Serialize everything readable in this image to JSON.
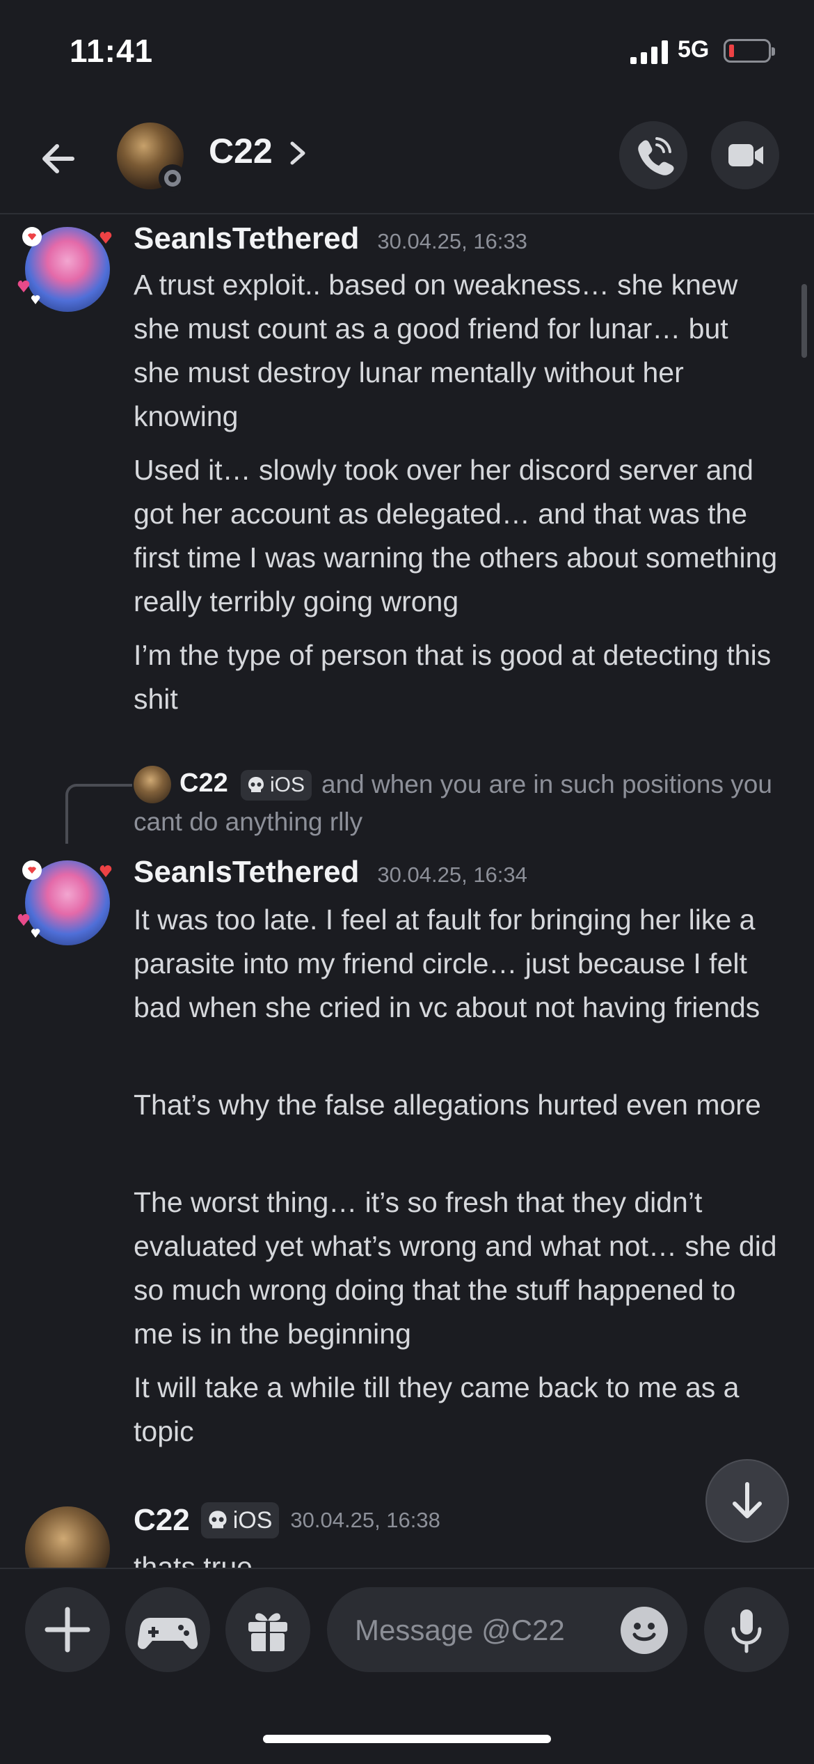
{
  "status_bar": {
    "time": "11:41",
    "network": "5G"
  },
  "header": {
    "title": "C22"
  },
  "messages": [
    {
      "username": "SeanIsTethered",
      "timestamp": "30.04.25, 16:33",
      "paragraphs": [
        "A trust exploit.. based on weakness… she knew she must count as a good friend for lunar… but she must destroy lunar mentally without her knowing",
        "Used it… slowly took over her discord server and got her account as delegated… and that was the first time I was warning the others about something really terribly going wrong",
        "I’m the type of person that is good at detecting this shit"
      ]
    },
    {
      "reply": {
        "username": "C22",
        "tag": "iOS",
        "text": "and when you are in such positions you cant do anything rlly"
      },
      "username": "SeanIsTethered",
      "timestamp": "30.04.25, 16:34",
      "paragraphs": [
        "It was too late. I feel at fault for bringing her like a parasite into my friend circle… just because I felt bad when she cried in vc about not having friends",
        "That’s why the false allegations hurted even more",
        "The worst thing… it’s so fresh that they didn’t evaluated yet what’s wrong and what not… she did so much wrong doing that the stuff happened to me is in the beginning",
        "It will take a while till they came back to me as a topic"
      ]
    },
    {
      "username": "C22",
      "tag": "iOS",
      "timestamp": "30.04.25, 16:38",
      "paragraphs": [
        "thats true"
      ]
    }
  ],
  "composer": {
    "placeholder": "Message @C22"
  },
  "icons": {
    "back": "arrow-left-icon",
    "chevron": "chevron-right-icon",
    "call": "phone-call-icon",
    "video": "video-camera-icon",
    "plus": "plus-icon",
    "games": "gamepad-icon",
    "gift": "gift-icon",
    "emoji": "smiley-icon",
    "mic": "microphone-icon",
    "scroll_down": "arrow-down-icon",
    "skull": "skull-icon"
  },
  "colors": {
    "background": "#1b1c21",
    "surface": "#2b2d33",
    "battery_low": "#ed4245"
  }
}
